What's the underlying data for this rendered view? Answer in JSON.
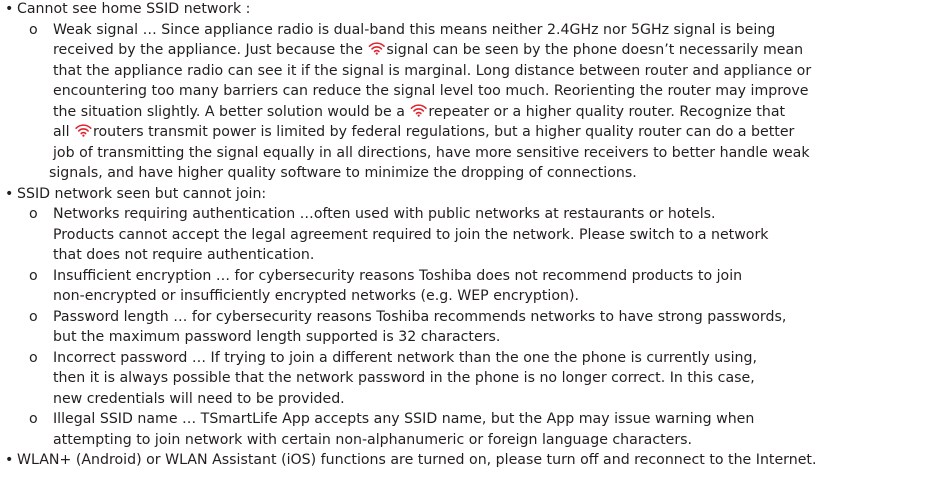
{
  "colors": {
    "text": "#231f20",
    "wifi_icon": "#e3212b"
  },
  "bullet_l1": "•",
  "bullet_l2": "o",
  "items": [
    {
      "title": "Cannot see home SSID network :",
      "sub": [
        {
          "lines": [
            "Weak signal … Since appliance radio is dual-band this means neither 2.4GHz nor 5GHz signal is being",
            [
              "received by the appliance.  Just because the ",
              "signal can be seen by the phone doesn’t necessarily mean"
            ],
            "that the appliance radio can see it if the signal is marginal.  Long distance between router and appliance or",
            "encountering too many barriers can reduce the signal  level too much.  Reorienting the router may improve",
            [
              "the situation slightly.  A better solution would be a ",
              "repeater or a higher quality router.  Recognize that"
            ],
            [
              "all ",
              "routers transmit power is limited by federal regulations, but a higher quality router can do a better"
            ],
            "job of  transmitting the signal equally in all directions, have more sensitive receivers to better handle weak",
            "signals, and have higher quality software to minimize the dropping of connections."
          ]
        }
      ]
    },
    {
      "title": "SSID network seen but cannot join:",
      "sub": [
        {
          "lines": [
            "Networks requiring authentication …often used with public networks at restaurants or hotels.",
            "Products cannot accept the legal agreement required to join the network.  Please switch to a network",
            "that does not require authentication."
          ]
        },
        {
          "lines": [
            "Insufficient encryption … for cybersecurity reasons Toshiba does not recommend products to join",
            "non-encrypted or insufficiently encrypted networks (e.g. WEP encryption)."
          ]
        },
        {
          "lines": [
            "Password length … for cybersecurity reasons Toshiba recommends networks to have strong passwords,",
            "but the maximum password length supported is 32 characters."
          ]
        },
        {
          "lines": [
            "Incorrect password … If trying to join a different network than the one the phone is currently using,",
            "then it is always possible that the network password in the phone is no longer correct.  In this case,",
            "new credentials will need to be provided."
          ]
        },
        {
          "lines": [
            "Illegal SSID name … TSmartLife App accepts any SSID name, but the App may issue warning when",
            "attempting to join network with certain non-alphanumeric or foreign language characters."
          ]
        }
      ]
    },
    {
      "title": "WLAN+ (Android) or WLAN Assistant (iOS) functions are turned on, please turn off and reconnect to the Internet.",
      "sub": []
    }
  ]
}
